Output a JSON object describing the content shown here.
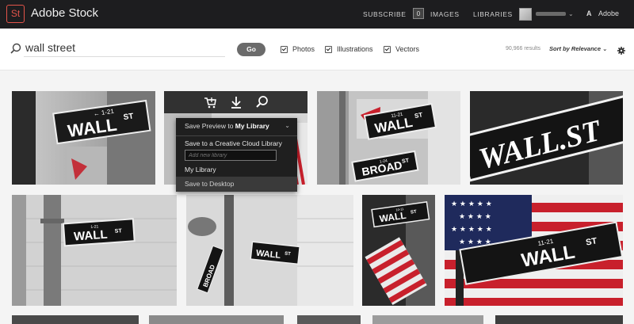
{
  "header": {
    "logo_mark": "St",
    "brand": "Adobe Stock",
    "subscribe": "SUBSCRIBE",
    "images_count": "0",
    "images": "IMAGES",
    "libraries": "LIBRARIES",
    "account_chevron": "⌄",
    "adobe_mark": "A",
    "adobe_label": "Adobe"
  },
  "search": {
    "value": "wall street",
    "go_label": "Go",
    "filters": [
      "Photos",
      "Illustrations",
      "Vectors"
    ],
    "results": "90,966 results",
    "sort": "Sort by Relevance ⌄"
  },
  "hover_menu": {
    "save_preview_prefix": "Save Preview to ",
    "save_preview_target": "My Library",
    "caret": "⌄",
    "save_cc": "Save to a Creative Cloud Library",
    "add_placeholder": "Add new library",
    "my_library": "My Library",
    "save_desktop": "Save to Desktop"
  },
  "tiles": [
    {
      "sign": "WALL",
      "sup": "ST",
      "num": "← 1-21"
    },
    {
      "sign": "",
      "sup": "",
      "num": ""
    },
    {
      "sign": "WALL",
      "sup": "ST",
      "num": "11-21",
      "sign2": "BROAD",
      "sup2": "ST",
      "num2": "1-24"
    },
    {
      "sign": "WALL.ST",
      "sup": "",
      "num": ""
    },
    {
      "sign": "WALL",
      "sup": "ST",
      "num": "1-21"
    },
    {
      "sign": "WALL",
      "sup": "ST",
      "num": "",
      "sign2": "BROAD"
    },
    {
      "sign": "WALL",
      "sup": "ST",
      "num": "10-11"
    },
    {
      "sign": "WALL",
      "sup": "ST",
      "num": "11-21"
    }
  ],
  "colors": {
    "brand_red": "#e3544a",
    "nav_bg": "#1d1d1f",
    "flag_red": "#c8202c",
    "flag_blue": "#1f2a5c"
  }
}
